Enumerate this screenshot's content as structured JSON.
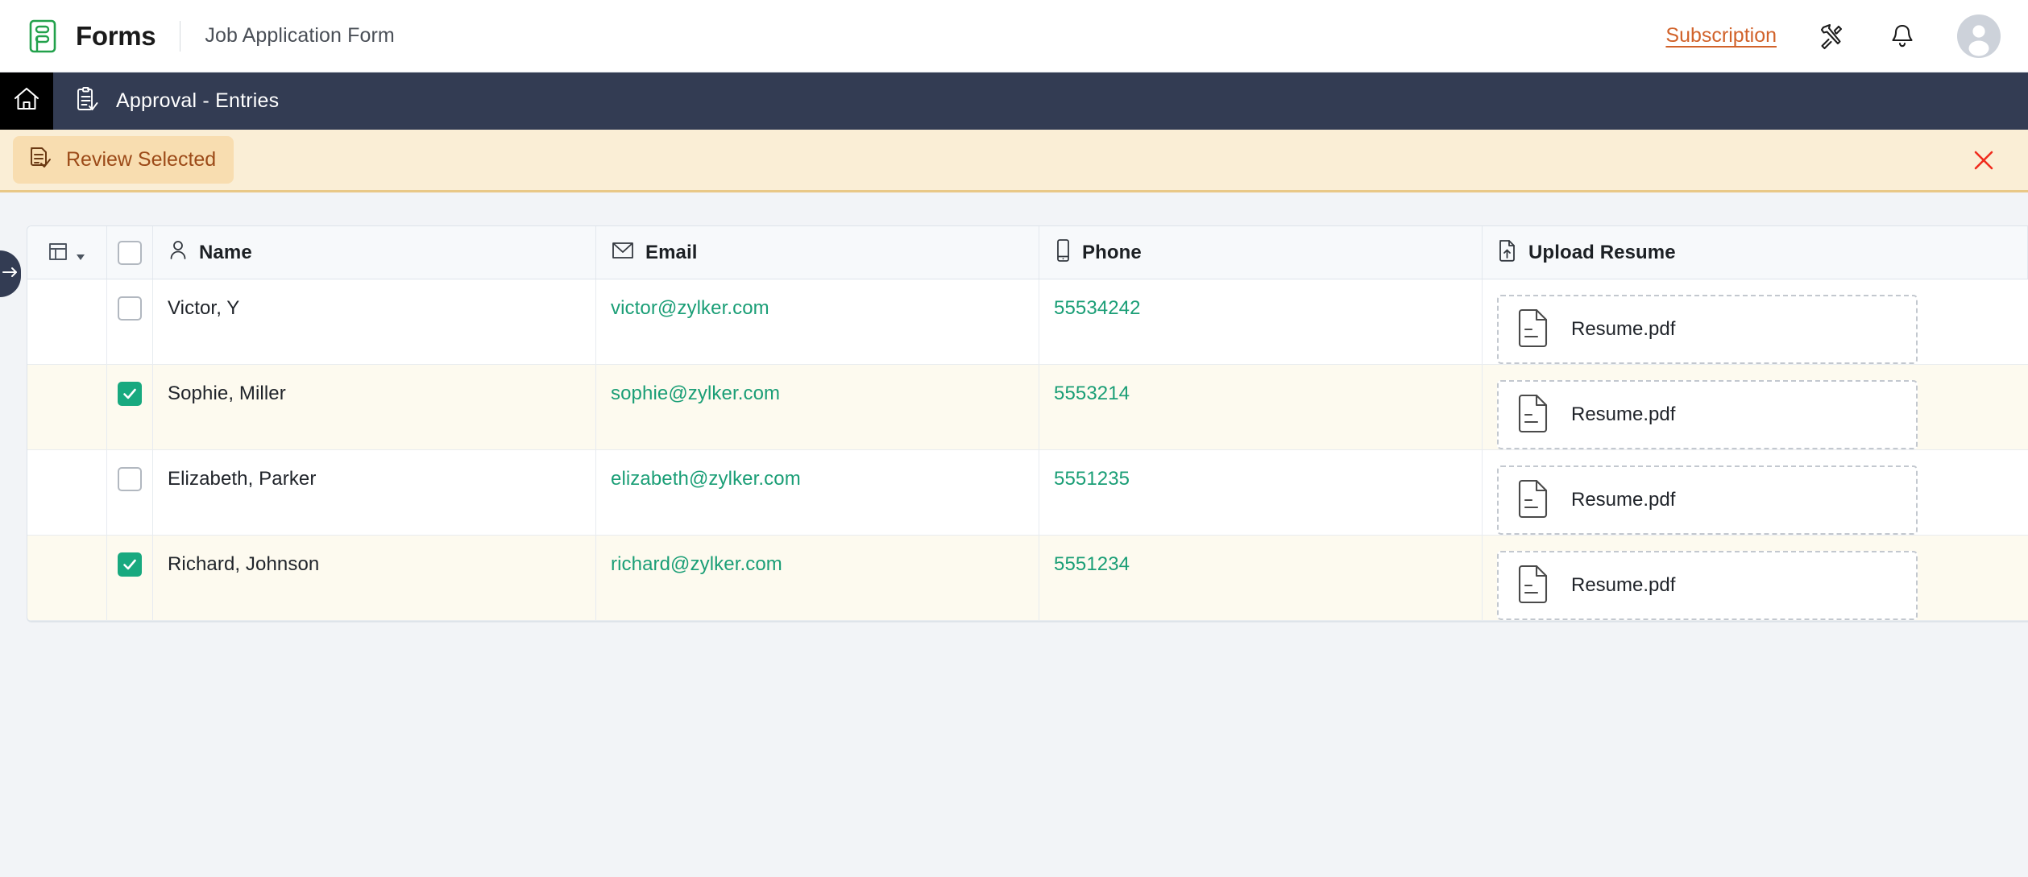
{
  "header": {
    "brand_name": "Forms",
    "form_title": "Job Application Form",
    "subscription_label": "Subscription",
    "tools_icon": "tools-icon",
    "bell_icon": "notification-bell-icon",
    "avatar_icon": "user-avatar-icon",
    "logo_icon": "forms-logo-icon"
  },
  "nav": {
    "home_icon": "home-icon",
    "entry_icon": "clipboard-check-icon",
    "entry_label": "Approval - Entries"
  },
  "review_bar": {
    "button_label": "Review Selected",
    "button_icon": "document-check-icon",
    "close_icon": "close-x-icon",
    "close_color": "#f02b1d",
    "background": "#faeed6",
    "button_background": "#f8ddb0",
    "text_color": "#9c4a18"
  },
  "table": {
    "sidebar_handle_icon": "arrow-right-icon",
    "layout_icon": "table-layout-icon",
    "layout_caret": "caret-down-icon",
    "select_all_checked": false,
    "columns": [
      {
        "key": "layout",
        "label": "",
        "icon": "table-layout-icon"
      },
      {
        "key": "select",
        "label": "",
        "icon": "checkbox-icon"
      },
      {
        "key": "name",
        "label": "Name",
        "icon": "person-icon"
      },
      {
        "key": "email",
        "label": "Email",
        "icon": "envelope-icon"
      },
      {
        "key": "phone",
        "label": "Phone",
        "icon": "mobile-phone-icon"
      },
      {
        "key": "resume",
        "label": "Upload Resume",
        "icon": "file-upload-icon"
      }
    ],
    "rows": [
      {
        "selected": false,
        "name": "Victor, Y",
        "email": "victor@zylker.com",
        "phone": "55534242",
        "resume": "Resume.pdf",
        "resume_icon": "document-file-icon"
      },
      {
        "selected": true,
        "name": "Sophie, Miller",
        "email": "sophie@zylker.com",
        "phone": "5553214",
        "resume": "Resume.pdf",
        "resume_icon": "document-file-icon"
      },
      {
        "selected": false,
        "name": "Elizabeth, Parker",
        "email": "elizabeth@zylker.com",
        "phone": "5551235",
        "resume": "Resume.pdf",
        "resume_icon": "document-file-icon"
      },
      {
        "selected": true,
        "name": "Richard, Johnson",
        "email": "richard@zylker.com",
        "phone": "5551234",
        "resume": "Resume.pdf",
        "resume_icon": "document-file-icon"
      }
    ]
  },
  "colors": {
    "accent_green": "#18a97f",
    "link_green": "#1a9e76",
    "subscription_orange": "#d1622a",
    "nav_dark": "#333c53",
    "page_bg": "#f2f4f7",
    "selected_row": "#fdfaef"
  }
}
